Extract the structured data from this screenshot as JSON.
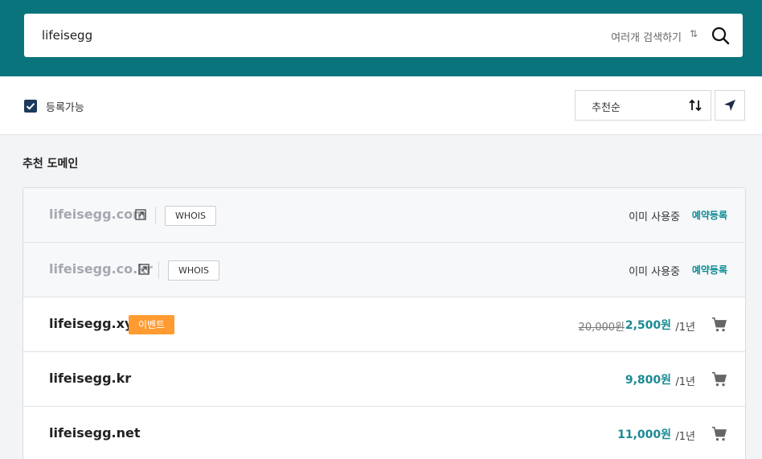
{
  "search": {
    "value": "lifeisegg",
    "multi_search_label": "여러개 검색하기",
    "swap_glyph": "⇅"
  },
  "filter": {
    "available_only_label": "등록가능",
    "available_only_checked": true,
    "sort_label": "추천순"
  },
  "section": {
    "title": "추천 도메인"
  },
  "domains": [
    {
      "name": "lifeisegg.com",
      "status": "이미 사용중",
      "action": "예약등록",
      "whois": "WHOIS"
    },
    {
      "name": "lifeisegg.co.kr",
      "status": "이미 사용중",
      "action": "예약등록",
      "whois": "WHOIS"
    },
    {
      "name": "lifeisegg.xyz",
      "badge": "이벤트",
      "original_price": "20,000원",
      "price": "2,500원",
      "period": "/1년"
    },
    {
      "name": "lifeisegg.kr",
      "price": "9,800원",
      "period": "/1년"
    },
    {
      "name": "lifeisegg.net",
      "price": "11,000원",
      "period": "/1년"
    }
  ],
  "colors": {
    "brand": "#0a747c",
    "price": "#1a8a93",
    "badge": "#ff9b30",
    "checkbox": "#1d3a5c"
  }
}
